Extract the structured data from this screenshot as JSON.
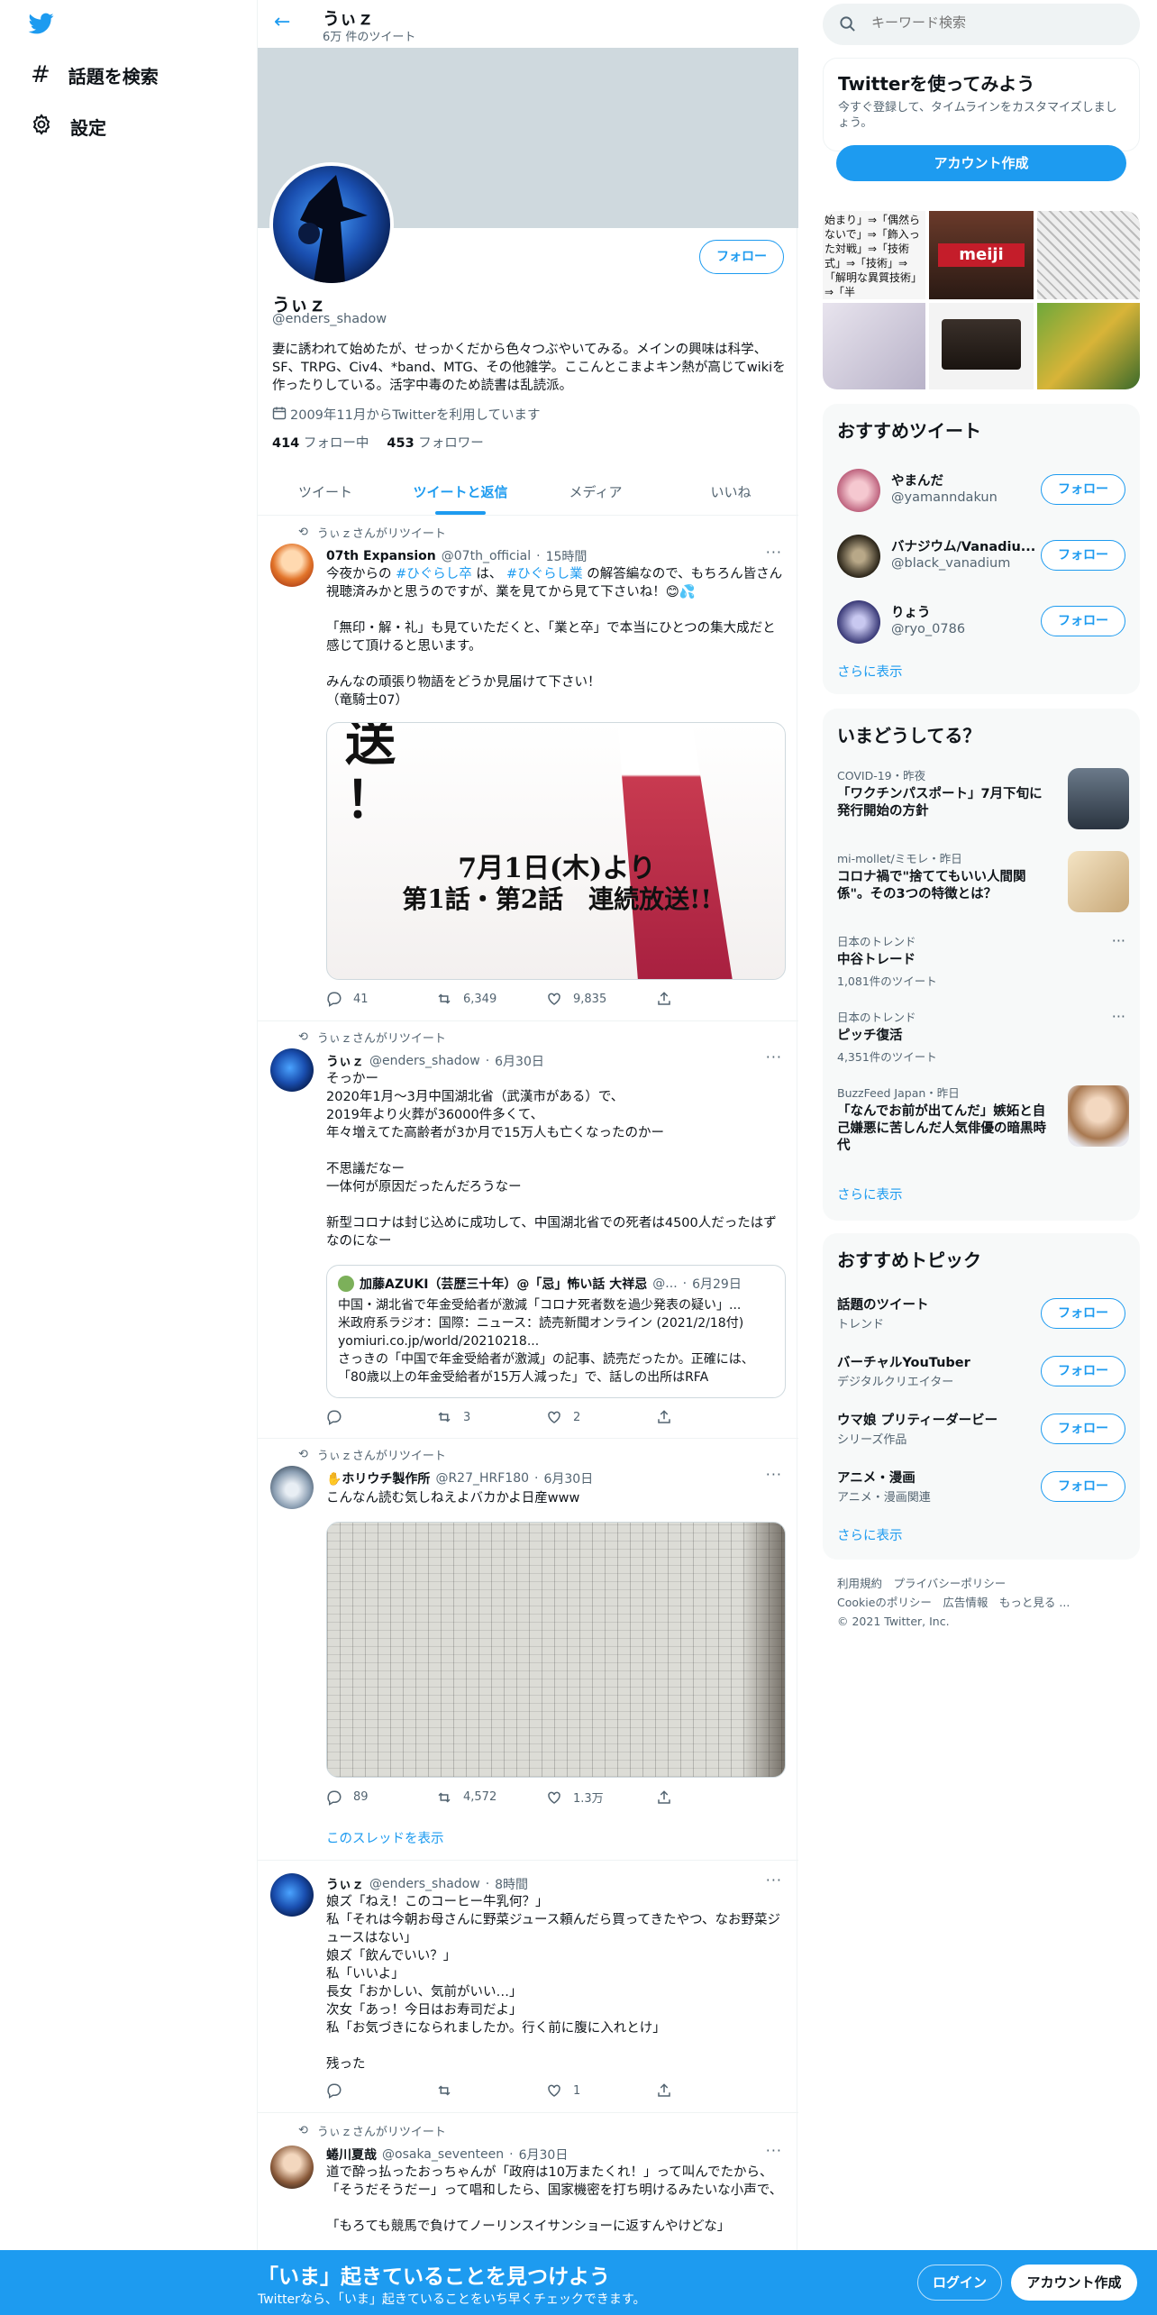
{
  "nav": {
    "search_label": "話題を検索",
    "settings_label": "設定"
  },
  "profile": {
    "header_name": "うぃｚ",
    "header_count": "6万 件のツイート",
    "name": "うぃｚ",
    "handle": "@enders_shadow",
    "bio": "妻に誘われて始めたが、せっかくだから色々つぶやいてみる。メインの興味は科学、SF、TRPG、Civ4、*band、MTG、その他雑学。ここんとこまよキン熱が高じてwikiを作ったりしている。活字中毒のため読書は乱読派。",
    "joined": "2009年11月からTwitterを利用しています",
    "following_count": "414",
    "following_label": "フォロー中",
    "followers_count": "453",
    "followers_label": "フォロワー",
    "follow_button": "フォロー"
  },
  "tabs": [
    "ツイート",
    "ツイートと返信",
    "メディア",
    "いいね"
  ],
  "tweets": [
    {
      "retweeter": "うぃｚさんがリツイート",
      "name": "07th Expansion",
      "handle": "@07th_official",
      "time": "15時間",
      "text_pre": "今夜からの ",
      "hashtag1": "#ひぐらし卒",
      "text_mid": " は、 ",
      "hashtag2": "#ひぐらし業",
      "text_post": " の解答編なので、もちろん皆さん視聴済みかと思うのですが、業を見てから見て下さいね！😊💦\n\n「無印・解・礼」も見ていただくと、「業と卒」で本当にひとつの集大成だと感じて頂けると思います。\n\nみんなの頑張り物語をどうか見届けて下さい！\n（竜騎士07）",
      "image_text1": "7月1日(木)より",
      "image_text2": "第1話・第2話　連続放送!!",
      "image_text3": "送\n！",
      "reply": "41",
      "retweet": "6,349",
      "like": "9,835"
    },
    {
      "retweeter": "うぃｚさんがリツイート",
      "name": "うぃｚ",
      "handle": "@enders_shadow",
      "time": "6月30日",
      "text": "そっかー\n2020年1月～3月中国湖北省（武漢市がある）で、\n2019年より火葬が36000件多くて、\n年々増えてた高齢者が3か月で15万人も亡くなったのかー\n\n不思議だなー\n一体何が原因だったんだろうなー\n\n新型コロナは封じ込めに成功して、中国湖北省での死者は4500人だったはずなのになー",
      "quote_name": "加藤AZUKI（芸歴三十年）@「忌」怖い話 大祥忌",
      "quote_handle": "@...",
      "quote_time": "6月29日",
      "quote_text": "中国・湖北省で年金受給者が激減「コロナ死者数を過少発表の疑い」...\n米政府系ラジオ：国際：ニュース：読売新聞オンライン (2021/2/18付)\nyomiuri.co.jp/world/20210218...\nさっきの「中国で年金受給者が激減」の記事、読売だったか。正確には、「80歳以上の年金受給者が15万人減った」で、話しの出所はRFA",
      "reply": "",
      "retweet": "3",
      "like": "2"
    },
    {
      "retweeter": "うぃｚさんがリツイート",
      "name": "✋ホリウチ製作所",
      "handle": "@R27_HRF180",
      "time": "6月30日",
      "text": "こんなん読む気しねえよバカかよ日産www",
      "reply": "89",
      "retweet": "4,572",
      "like": "1.3万",
      "thread_link": "このスレッドを表示"
    },
    {
      "name": "うぃｚ",
      "handle": "@enders_shadow",
      "time": "8時間",
      "text": "娘ズ「ねえ！このコーヒー牛乳何？」\n私「それは今朝お母さんに野菜ジュース頼んだら買ってきたやつ、なお野菜ジュースはない」\n娘ズ「飲んでいい？」\n私「いいよ」\n長女「おかしい、気前がいい…」\n次女「あっ！今日はお寿司だよ」\n私「お気づきになられましたか。行く前に腹に入れとけ」\n\n残った",
      "reply": "",
      "retweet": "",
      "like": "1"
    },
    {
      "retweeter": "うぃｚさんがリツイート",
      "name": "蜷川夏哉",
      "handle": "@osaka_seventeen",
      "time": "6月30日",
      "text": "道で酔っ払ったおっちゃんが「政府は10万またくれ！」って叫んでたから、「そうだそうだー」って唱和したら、国家機密を打ち明けるみたいな小声で、\n\n「もろても競馬で負けてノーリンスイサンショーに返すんやけどな」"
    }
  ],
  "sidebar": {
    "search_placeholder": "キーワード検索",
    "signup_title": "Twitterを使ってみよう",
    "signup_desc": "今すぐ登録して、タイムラインをカスタマイズしましょう。",
    "signup_button": "アカウント作成",
    "media_text": "始まり」⇒「偶然らないで」⇒「飾入った対戦」⇒「技術式」⇒「技術」⇒「解明な異質技術」⇒「半",
    "media_brand": "meiji",
    "recommend_title": "おすすめツイート",
    "recommend": [
      {
        "name": "やまんだ",
        "handle": "@yamanndakun"
      },
      {
        "name": "バナジウム/Vanadiu...",
        "handle": "@black_vanadium"
      },
      {
        "name": "りょう",
        "handle": "@ryo_0786"
      }
    ],
    "follow_label": "フォロー",
    "show_more": "さらに表示",
    "trends_title": "いまどうしてる？",
    "trends": [
      {
        "meta": "COVID-19・昨夜",
        "title": "「ワクチンパスポート」7月下旬に発行開始の方針"
      },
      {
        "meta": "mi-mollet/ミモレ・昨日",
        "title": "コロナ禍で\"捨ててもいい人間関係\"。その3つの特徴とは？"
      },
      {
        "meta": "日本のトレンド",
        "title": "中谷トレード",
        "count": "1,081件のツイート"
      },
      {
        "meta": "日本のトレンド",
        "title": "ピッチ復活",
        "count": "4,351件のツイート"
      },
      {
        "meta": "BuzzFeed Japan・昨日",
        "title": "「なんでお前が出てんだ」嫉妬と自己嫌悪に苦しんだ人気俳優の暗黒時代"
      }
    ],
    "topics_title": "おすすめトピック",
    "topics": [
      {
        "name": "話題のツイート",
        "sub": "トレンド"
      },
      {
        "name": "バーチャルYouTuber",
        "sub": "デジタルクリエイター"
      },
      {
        "name": "ウマ娘 プリティーダービー",
        "sub": "シリーズ作品"
      },
      {
        "name": "アニメ・漫画",
        "sub": "アニメ・漫画関連"
      }
    ],
    "footer_line1": "利用規約　プライバシーポリシー",
    "footer_line2": "Cookieのポリシー　広告情報　もっと見る ...",
    "footer_line3": "© 2021 Twitter, Inc."
  },
  "bottom_bar": {
    "title": "「いま」起きていることを見つけよう",
    "sub": "Twitterなら、「いま」起きていることをいち早くチェックできます。",
    "login": "ログイン",
    "signup": "アカウント作成"
  },
  "colors": {
    "accent": "#1d9bf0",
    "banner": "#cfd9de",
    "bottom_bar": "#1d9bf0"
  }
}
